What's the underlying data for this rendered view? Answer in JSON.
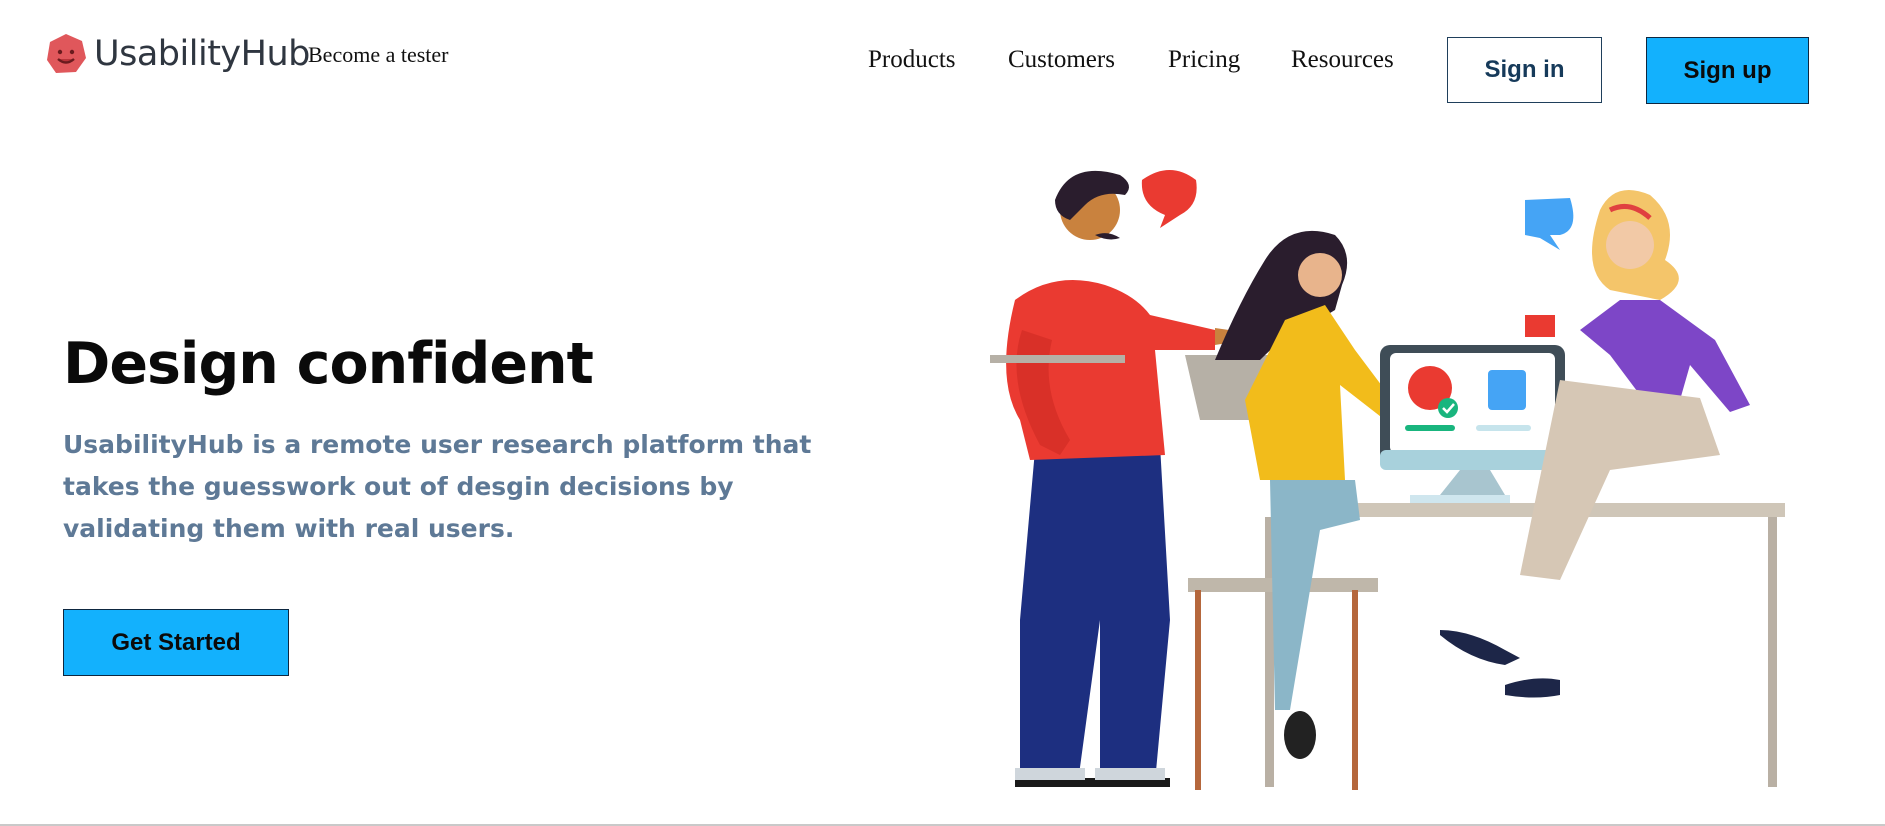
{
  "header": {
    "brand": "UsabilityHub",
    "tester_link": "Become a tester",
    "nav": [
      "Products",
      "Customers",
      "Pricing",
      "Resources"
    ],
    "sign_in": "Sign in",
    "sign_up": "Sign up"
  },
  "hero": {
    "title": "Design confident",
    "description": "UsabilityHub is a remote user research platform that takes the guesswork out of desgin decisions by validating them with real users.",
    "cta": "Get Started"
  },
  "colors": {
    "accent": "#13b1fd",
    "logo": "#e0575b",
    "description": "#5e7996"
  },
  "icons": {
    "logo": "usabilityhub-face-icon",
    "check": "check-icon"
  }
}
